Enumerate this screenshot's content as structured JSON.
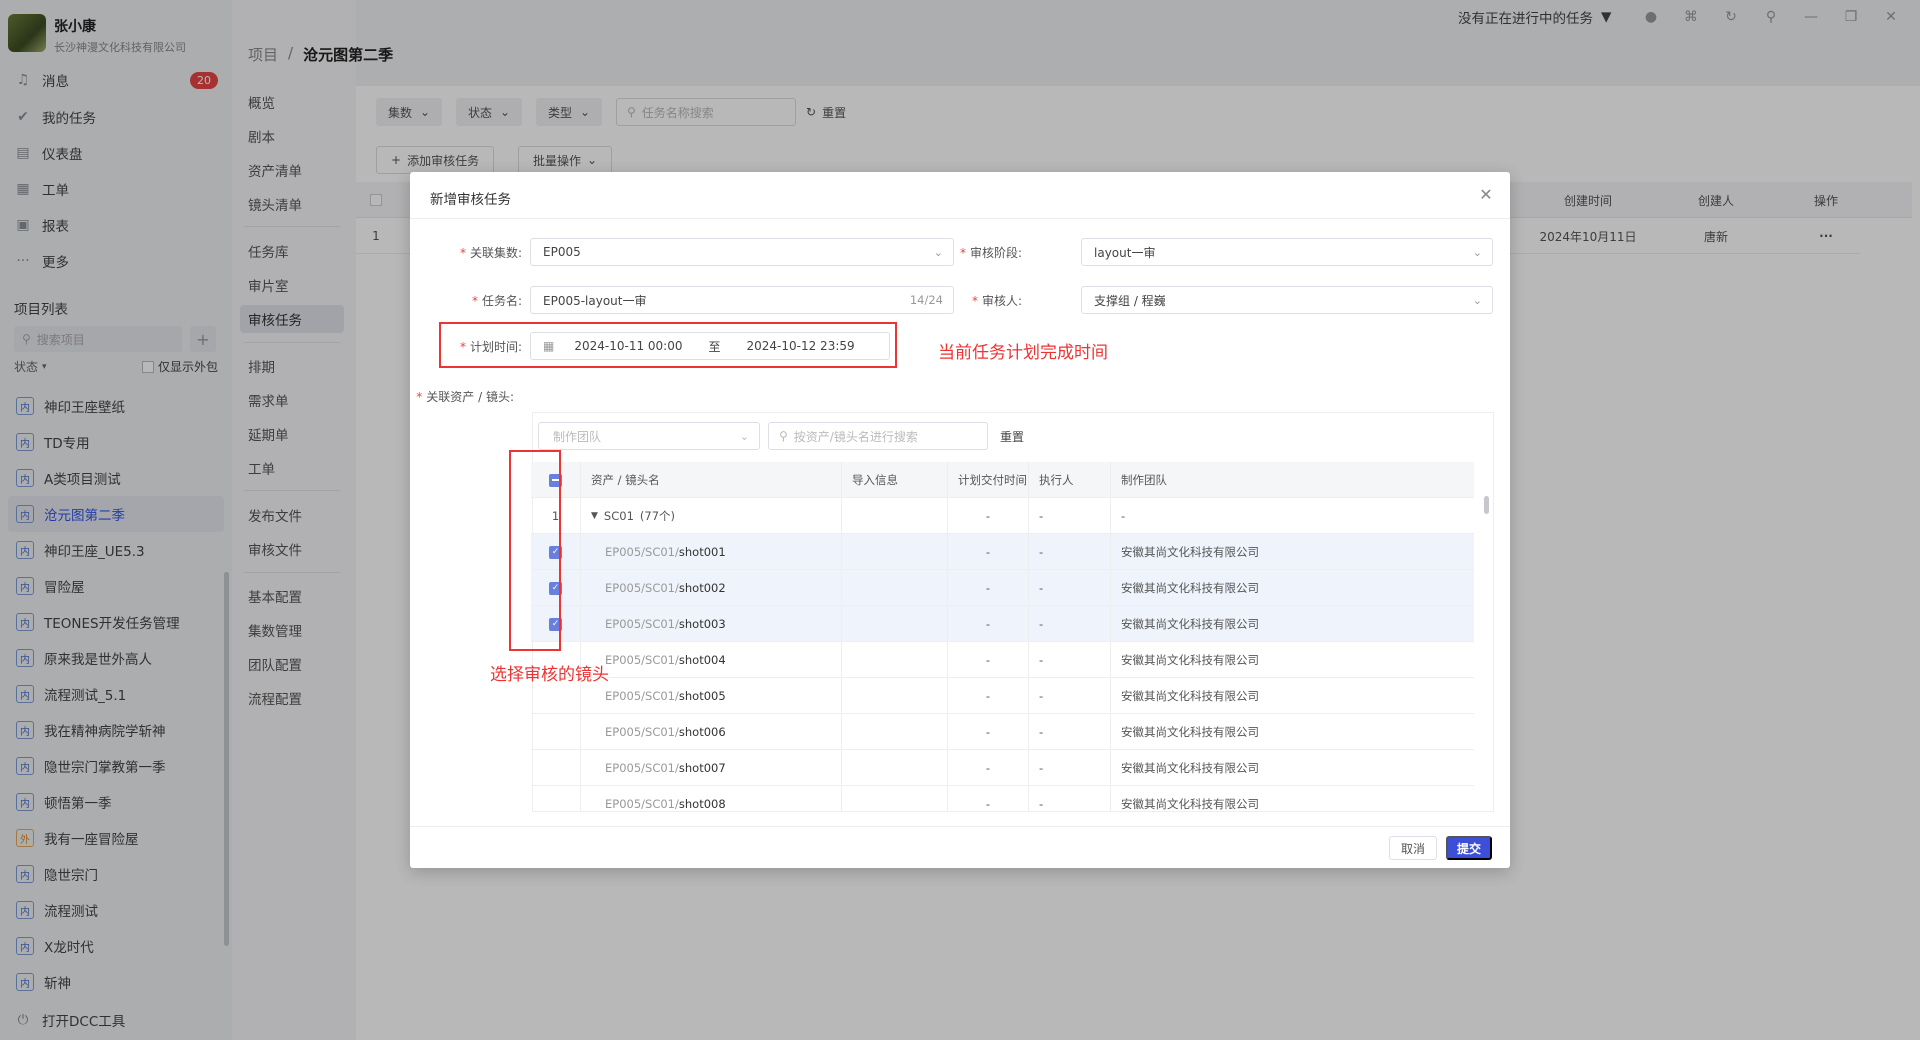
{
  "topbar": {
    "task_status": "没有正在进行中的任务"
  },
  "user": {
    "name": "张小康",
    "company": "长沙神漫文化科技有限公司"
  },
  "nav": {
    "items": [
      {
        "label": "消息",
        "icon": "bell-icon"
      },
      {
        "label": "我的任务",
        "icon": "check-icon"
      },
      {
        "label": "仪表盘",
        "icon": "dashboard-icon"
      },
      {
        "label": "工单",
        "icon": "ticket-icon"
      },
      {
        "label": "报表",
        "icon": "report-icon"
      },
      {
        "label": "更多",
        "icon": "more-icon"
      }
    ],
    "message_badge": "20"
  },
  "projects": {
    "title": "项目列表",
    "search_placeholder": "搜索项目",
    "status_label": "状态",
    "outsource_label": "仅显示外包",
    "items": [
      {
        "tag": "内",
        "label": "神印王座壁纸"
      },
      {
        "tag": "内",
        "label": "TD专用"
      },
      {
        "tag": "内",
        "label": "A类项目测试"
      },
      {
        "tag": "内",
        "label": "沧元图第二季"
      },
      {
        "tag": "内",
        "label": "神印王座_UE5.3"
      },
      {
        "tag": "内",
        "label": "冒险屋"
      },
      {
        "tag": "内",
        "label": "TEONES开发任务管理"
      },
      {
        "tag": "内",
        "label": "原来我是世外高人"
      },
      {
        "tag": "内",
        "label": "流程测试_5.1"
      },
      {
        "tag": "内",
        "label": "我在精神病院学斩神"
      },
      {
        "tag": "内",
        "label": "隐世宗门掌教第一季"
      },
      {
        "tag": "内",
        "label": "顿悟第一季"
      },
      {
        "tag": "外",
        "label": "我有一座冒险屋"
      },
      {
        "tag": "内",
        "label": "隐世宗门"
      },
      {
        "tag": "内",
        "label": "流程测试"
      },
      {
        "tag": "内",
        "label": "X龙时代"
      },
      {
        "tag": "内",
        "label": "斩神"
      }
    ],
    "dcc_label": "打开DCC工具"
  },
  "breadcrumb": {
    "root": "项目",
    "sep": "/",
    "current": "沧元图第二季"
  },
  "submenu": {
    "items": [
      "概览",
      "剧本",
      "资产清单",
      "镜头清单",
      "任务库",
      "审片室",
      "审核任务",
      "排期",
      "需求单",
      "延期单",
      "工单",
      "发布文件",
      "审核文件",
      "基本配置",
      "集数管理",
      "团队配置",
      "流程配置"
    ]
  },
  "main": {
    "filter_episodes": "集数",
    "filter_status": "状态",
    "filter_type": "类型",
    "search_placeholder": "任务名称搜索",
    "reset_label": "重置",
    "add_label": "添加审核任务",
    "batch_label": "批量操作",
    "col_created_time": "创建时间",
    "col_creator": "创建人",
    "col_actions": "操作",
    "row_index": "1",
    "row_created_time": "2024年10月11日",
    "row_creator": "唐新",
    "row_more": "···"
  },
  "modal": {
    "title": "新增审核任务",
    "episode_label": "关联集数:",
    "episode_value": "EP005",
    "stage_label": "审核阶段:",
    "stage_value": "layout一审",
    "task_name_label": "任务名:",
    "task_name_value": "EP005-layout一审",
    "task_name_count": "14/24",
    "reviewer_label": "审核人:",
    "reviewer_value": "支撑组 / 程巍",
    "plan_time_label": "计划时间:",
    "plan_start": "2024-10-11 00:00",
    "plan_sep": "至",
    "plan_end": "2024-10-12 23:59",
    "assets_label": "关联资产 / 镜头:",
    "team_placeholder": "制作团队",
    "asset_search_placeholder": "按资产/镜头名进行搜索",
    "asset_reset": "重置",
    "cancel_label": "取消",
    "submit_label": "提交"
  },
  "grid": {
    "headers": [
      "资产 / 镜头名",
      "导入信息",
      "计划交付时间",
      "执行人",
      "制作团队"
    ],
    "group": {
      "index": "1",
      "name": "SC01",
      "count": "(77个)",
      "delivery": "-",
      "executor": "-",
      "team": "-"
    },
    "rows": [
      {
        "prefix": "EP005/SC01/",
        "shot": "shot001",
        "delivery": "-",
        "executor": "-",
        "team": "安徽其尚文化科技有限公司",
        "checked": true
      },
      {
        "prefix": "EP005/SC01/",
        "shot": "shot002",
        "delivery": "-",
        "executor": "-",
        "team": "安徽其尚文化科技有限公司",
        "checked": true
      },
      {
        "prefix": "EP005/SC01/",
        "shot": "shot003",
        "delivery": "-",
        "executor": "-",
        "team": "安徽其尚文化科技有限公司",
        "checked": true
      },
      {
        "prefix": "EP005/SC01/",
        "shot": "shot004",
        "delivery": "-",
        "executor": "-",
        "team": "安徽其尚文化科技有限公司",
        "checked": false
      },
      {
        "prefix": "EP005/SC01/",
        "shot": "shot005",
        "delivery": "-",
        "executor": "-",
        "team": "安徽其尚文化科技有限公司",
        "checked": false
      },
      {
        "prefix": "EP005/SC01/",
        "shot": "shot006",
        "delivery": "-",
        "executor": "-",
        "team": "安徽其尚文化科技有限公司",
        "checked": false
      },
      {
        "prefix": "EP005/SC01/",
        "shot": "shot007",
        "delivery": "-",
        "executor": "-",
        "team": "安徽其尚文化科技有限公司",
        "checked": false
      },
      {
        "prefix": "EP005/SC01/",
        "shot": "shot008",
        "delivery": "-",
        "executor": "-",
        "team": "安徽其尚文化科技有限公司",
        "checked": false
      }
    ]
  },
  "annotations": {
    "time_note": "当前任务计划完成时间",
    "shots_note": "选择审核的镜头"
  },
  "colors": {
    "accent": "#3d4fd9",
    "checkbox": "#6a7fdc",
    "annotation": "#e33333",
    "badge": "#e64545"
  }
}
